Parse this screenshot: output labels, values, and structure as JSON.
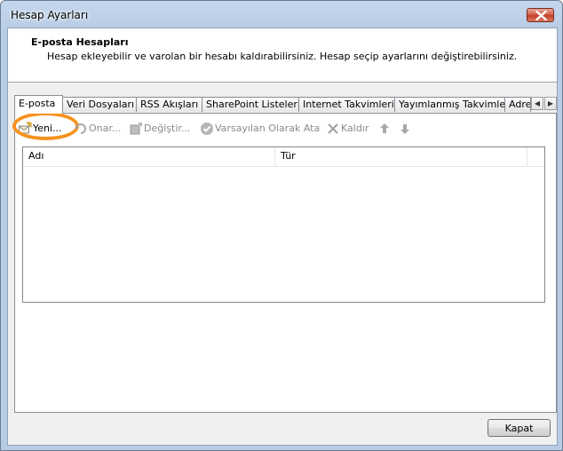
{
  "window": {
    "title": "Hesap Ayarları"
  },
  "header": {
    "title": "E-posta Hesapları",
    "description": "Hesap ekleyebilir ve varolan bir hesabı kaldırabilirsiniz. Hesap seçip ayarlarını değiştirebilirsiniz."
  },
  "tabs": [
    {
      "label": "E-posta",
      "active": true
    },
    {
      "label": "Veri Dosyaları"
    },
    {
      "label": "RSS Akışları"
    },
    {
      "label": "SharePoint Listeleri"
    },
    {
      "label": "Internet Takvimleri"
    },
    {
      "label": "Yayımlanmış Takvimler"
    },
    {
      "label": "Adres Defterleri"
    }
  ],
  "toolbar": {
    "new_label": "Yeni...",
    "repair_label": "Onar...",
    "change_label": "Değiştir...",
    "default_label": "Varsayılan Olarak Ata",
    "remove_label": "Kaldır",
    "icons": {
      "new": "new-account-icon",
      "repair": "repair-icon",
      "change": "change-icon",
      "default": "checkmark-icon",
      "remove": "x-icon",
      "up": "arrow-up-icon",
      "down": "arrow-down-icon"
    }
  },
  "list": {
    "columns": [
      "Adı",
      "Tür"
    ],
    "rows": []
  },
  "footer": {
    "close_label": "Kapat"
  },
  "colors": {
    "highlight_ring": "#f6921e",
    "close_button": "#c3412a"
  }
}
